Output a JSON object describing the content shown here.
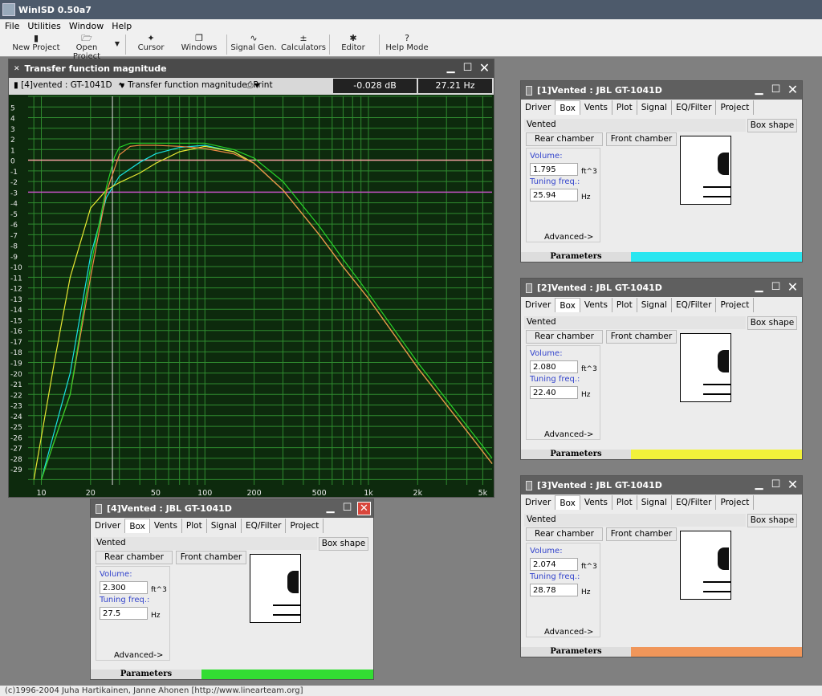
{
  "app": {
    "title": "WinISD 0.50a7",
    "statusbar": "(c)1996-2004 Juha Hartikainen, Janne Ahonen [http://www.linearteam.org]"
  },
  "menu": [
    "File",
    "Utilities",
    "Window",
    "Help"
  ],
  "toolbar": [
    {
      "label": "New Project",
      "icon": "new-project-icon",
      "glyph": "▮"
    },
    {
      "label": "Open Project",
      "icon": "open-folder-icon",
      "glyph": "🗁"
    },
    {
      "label": "Cursor",
      "icon": "cursor-icon",
      "glyph": "✦"
    },
    {
      "label": "Windows",
      "icon": "windows-icon",
      "glyph": "❐"
    },
    {
      "label": "Signal Gen.",
      "icon": "signal-icon",
      "glyph": "∿"
    },
    {
      "label": "Calculators",
      "icon": "calculator-icon",
      "glyph": "±"
    },
    {
      "label": "Editor",
      "icon": "editor-icon",
      "glyph": "✱"
    },
    {
      "label": "Help Mode",
      "icon": "help-icon",
      "glyph": "?"
    }
  ],
  "graph": {
    "title": "Transfer function magnitude",
    "project_select": "[4]vented : GT-1041D",
    "plot_select": "Transfer function magnitude",
    "print": "Print",
    "readout_db": "-0.028 dB",
    "readout_hz": "27.21 Hz"
  },
  "chart_data": {
    "type": "line",
    "title": "",
    "xlabel": "",
    "ylabel": "",
    "x_scale": "log",
    "xlim": [
      8.3,
      5700
    ],
    "ylim": [
      -30.5,
      6
    ],
    "x_ticks": [
      10,
      20,
      50,
      100,
      200,
      500,
      1000,
      2000,
      5000
    ],
    "x_tick_labels": [
      "10",
      "20",
      "50",
      "100",
      "200",
      "500",
      "1k",
      "2k",
      "5k"
    ],
    "y_ticks": [
      5,
      4,
      3,
      2,
      1,
      0,
      -1,
      -2,
      -3,
      -4,
      -5,
      -6,
      -7,
      -8,
      -9,
      -10,
      -11,
      -12,
      -13,
      -14,
      -15,
      -16,
      -17,
      -18,
      -19,
      -20,
      -21,
      -22,
      -23,
      -24,
      -25,
      -26,
      -27,
      -28,
      -29
    ],
    "reference_lines": [
      {
        "y": 0,
        "color": "#f4a0a0"
      },
      {
        "y": -3,
        "color": "#c050c0"
      }
    ],
    "cursor_x": 27.21,
    "grid": true,
    "series": [
      {
        "color": "#19e3e3",
        "x": [
          10,
          15,
          20,
          25,
          30,
          40,
          50,
          70,
          100,
          150,
          200,
          300,
          500,
          700,
          1000,
          2000,
          5700
        ],
        "y": [
          -30,
          -20,
          -9,
          -3.5,
          -1.5,
          -0.2,
          0.6,
          1.2,
          1.4,
          0.8,
          -0.3,
          -2.8,
          -7,
          -10,
          -13,
          -19.5,
          -28.5
        ]
      },
      {
        "color": "#e6e632",
        "x": [
          9,
          10,
          12,
          15,
          20,
          25,
          30,
          40,
          50,
          70,
          100,
          150,
          200,
          300,
          500,
          700,
          1000,
          2000,
          5700
        ],
        "y": [
          -30,
          -26,
          -19,
          -11,
          -4.5,
          -2.8,
          -2.1,
          -1.2,
          -0.3,
          0.8,
          1.3,
          0.8,
          -0.3,
          -2.8,
          -7,
          -10,
          -13,
          -19.5,
          -28.5
        ]
      },
      {
        "color": "#ee8844",
        "x": [
          10,
          15,
          20,
          25,
          30,
          35,
          40,
          50,
          70,
          100,
          150,
          200,
          300,
          500,
          700,
          1000,
          2000,
          5700
        ],
        "y": [
          -30,
          -22,
          -11,
          -3,
          0.5,
          1.3,
          1.4,
          1.4,
          1.3,
          1.1,
          0.6,
          -0.3,
          -2.8,
          -7,
          -10,
          -13,
          -19.5,
          -28.5
        ]
      },
      {
        "color": "#28d228",
        "x": [
          10,
          15,
          20,
          25,
          28,
          30,
          35,
          40,
          50,
          70,
          100,
          150,
          200,
          300,
          500,
          700,
          1000,
          2000,
          5700
        ],
        "y": [
          -30,
          -22,
          -10,
          -2.5,
          0.3,
          1.2,
          1.6,
          1.6,
          1.6,
          1.6,
          1.6,
          1,
          0.2,
          -2,
          -6.2,
          -9.3,
          -12.5,
          -19,
          -28
        ]
      }
    ]
  },
  "panels": [
    {
      "title": "[1]Vented : JBL GT-1041D",
      "type_value": "Vented",
      "volume": "1.795",
      "tuning": "25.94",
      "color": "#29e6f0"
    },
    {
      "title": "[2]Vented : JBL GT-1041D",
      "type_value": "Vented",
      "volume": "2.080",
      "tuning": "22.40",
      "color": "#f2f23a"
    },
    {
      "title": "[3]Vented : JBL GT-1041D",
      "type_value": "Vented",
      "volume": "2.074",
      "tuning": "28.78",
      "color": "#f0965a"
    },
    {
      "title": "[4]Vented : JBL GT-1041D",
      "type_value": "Vented",
      "volume": "2.300",
      "tuning": "27.5",
      "color": "#33dd33"
    }
  ],
  "panel_common": {
    "tabs": [
      "Driver",
      "Box",
      "Vents",
      "Plot",
      "Signal",
      "EQ/Filter",
      "Project"
    ],
    "box_shape": "Box shape",
    "rear": "Rear chamber",
    "front": "Front chamber",
    "volume_label": "Volume:",
    "volume_unit": "ft^3",
    "tuning_label": "Tuning freq.:",
    "tuning_unit": "Hz",
    "advanced": "Advanced->",
    "params": "Parameters"
  }
}
